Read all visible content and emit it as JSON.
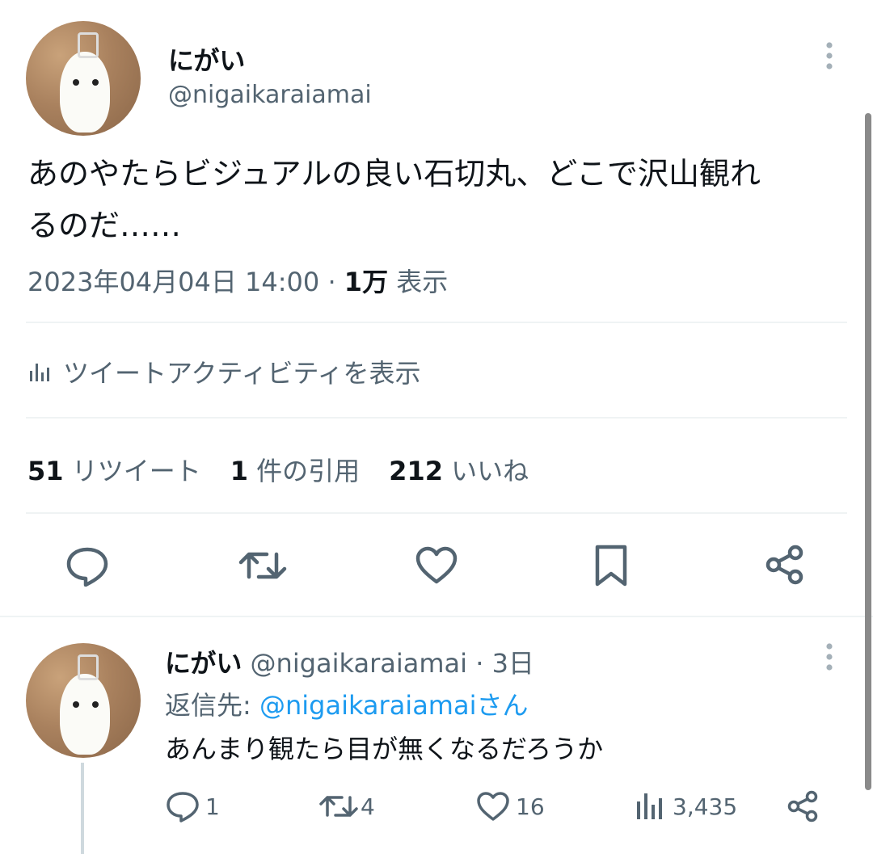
{
  "main_tweet": {
    "author_name": "にがい",
    "author_handle": "@nigaikaraiamai",
    "text_line1": "あのやたらビジュアルの良い石切丸、どこで沢山観れ",
    "text_line2": "るのだ……",
    "timestamp": "2023年04月04日 14:00",
    "separator": "·",
    "views_count": "1万",
    "views_label": "表示",
    "activity_label": "ツイートアクティビティを表示",
    "stats": {
      "retweets_count": "51",
      "retweets_label": "リツイート",
      "quotes_count": "1",
      "quotes_label": "件の引用",
      "likes_count": "212",
      "likes_label": "いいね"
    }
  },
  "reply": {
    "author_name": "にがい",
    "author_handle": "@nigaikaraiamai",
    "separator": "·",
    "time": "3日",
    "reply_to_prefix": "返信先: ",
    "reply_to_handle": "@nigaikaraiamai",
    "reply_to_suffix": "さん",
    "text": "あんまり観たら目が無くなるだろうか",
    "counts": {
      "replies": "1",
      "retweets": "4",
      "likes": "16",
      "views": "3,435"
    }
  },
  "colors": {
    "text": "#0f1419",
    "muted": "#536471",
    "link": "#1d9bf0",
    "divider": "#eff3f4"
  },
  "icons": [
    "more-icon",
    "activity-icon",
    "reply-icon",
    "retweet-icon",
    "like-icon",
    "bookmark-icon",
    "share-icon",
    "views-icon"
  ]
}
